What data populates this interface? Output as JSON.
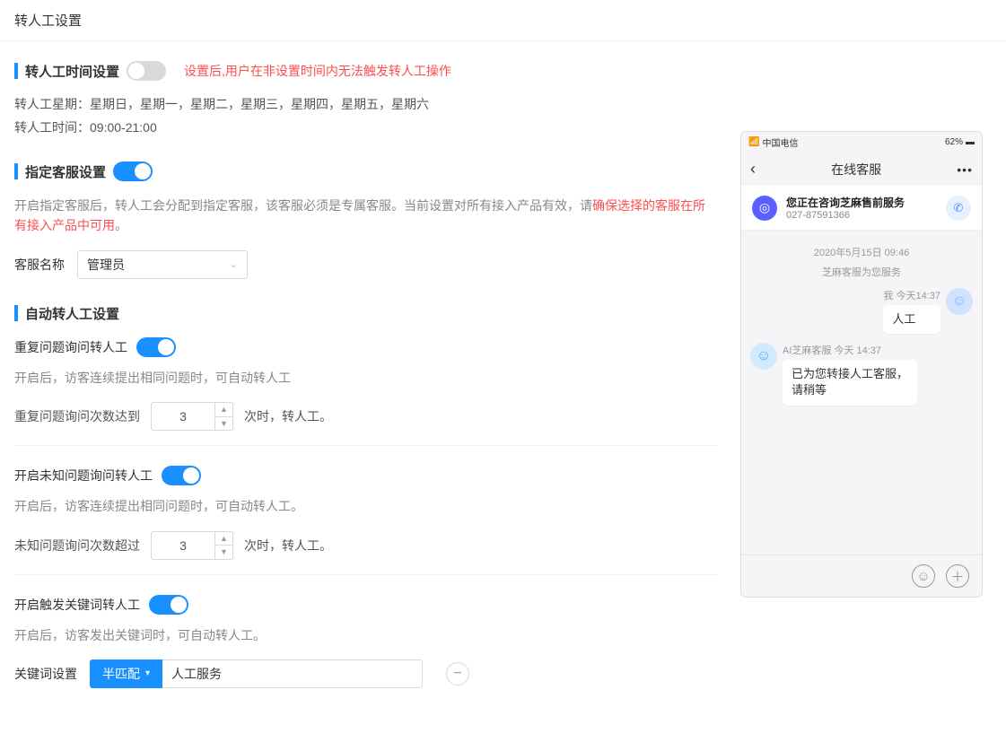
{
  "page_title": "转人工设置",
  "section1": {
    "title": "转人工时间设置",
    "toggle_on": false,
    "hint_red": "设置后,用户在非设置时间内无法触发转人工操作",
    "weekday_label": "转人工星期：",
    "weekday_value": "星期日，星期一，星期二，星期三，星期四，星期五，星期六",
    "time_label": "转人工时间：",
    "time_value": "09:00-21:00"
  },
  "section2": {
    "title": "指定客服设置",
    "toggle_on": true,
    "desc_prefix": "开启指定客服后，转人工会分配到指定客服，该客服必须是专属客服。当前设置对所有接入产品有效，请",
    "desc_red": "确保选择的客服在所有接入产品中可用",
    "desc_suffix": "。",
    "name_label": "客服名称",
    "name_value": "管理员"
  },
  "section3": {
    "title": "自动转人工设置",
    "repeat": {
      "label": "重复问题询问转人工",
      "toggle_on": true,
      "desc": "开启后，访客连续提出相同问题时，可自动转人工",
      "count_lbl": "重复问题询问次数达到",
      "count_val": "3",
      "count_suf": "次时，转人工。"
    },
    "unknown": {
      "label": "开启未知问题询问转人工",
      "toggle_on": true,
      "desc": "开启后，访客连续提出相同问题时，可自动转人工。",
      "count_lbl": "未知问题询问次数超过",
      "count_val": "3",
      "count_suf": "次时，转人工。"
    },
    "keyword": {
      "label": "开启触发关键词转人工",
      "toggle_on": true,
      "desc": "开启后，访客发出关键词时，可自动转人工。",
      "set_lbl": "关键词设置",
      "match_mode": "半匹配",
      "input_val": "人工服务"
    }
  },
  "preview": {
    "carrier": "中国电信",
    "battery": "62%",
    "header_title": "在线客服",
    "banner_title": "您正在咨询芝麻售前服务",
    "banner_sub": "027-87591366",
    "date_line": "2020年5月15日 09:46",
    "sys_line": "芝麻客服为您服务",
    "user_meta": "我 今天14:37",
    "user_msg": "人工",
    "bot_meta": "AI芝麻客服 今天 14:37",
    "bot_msg": "已为您转接人工客服，请稍等"
  }
}
